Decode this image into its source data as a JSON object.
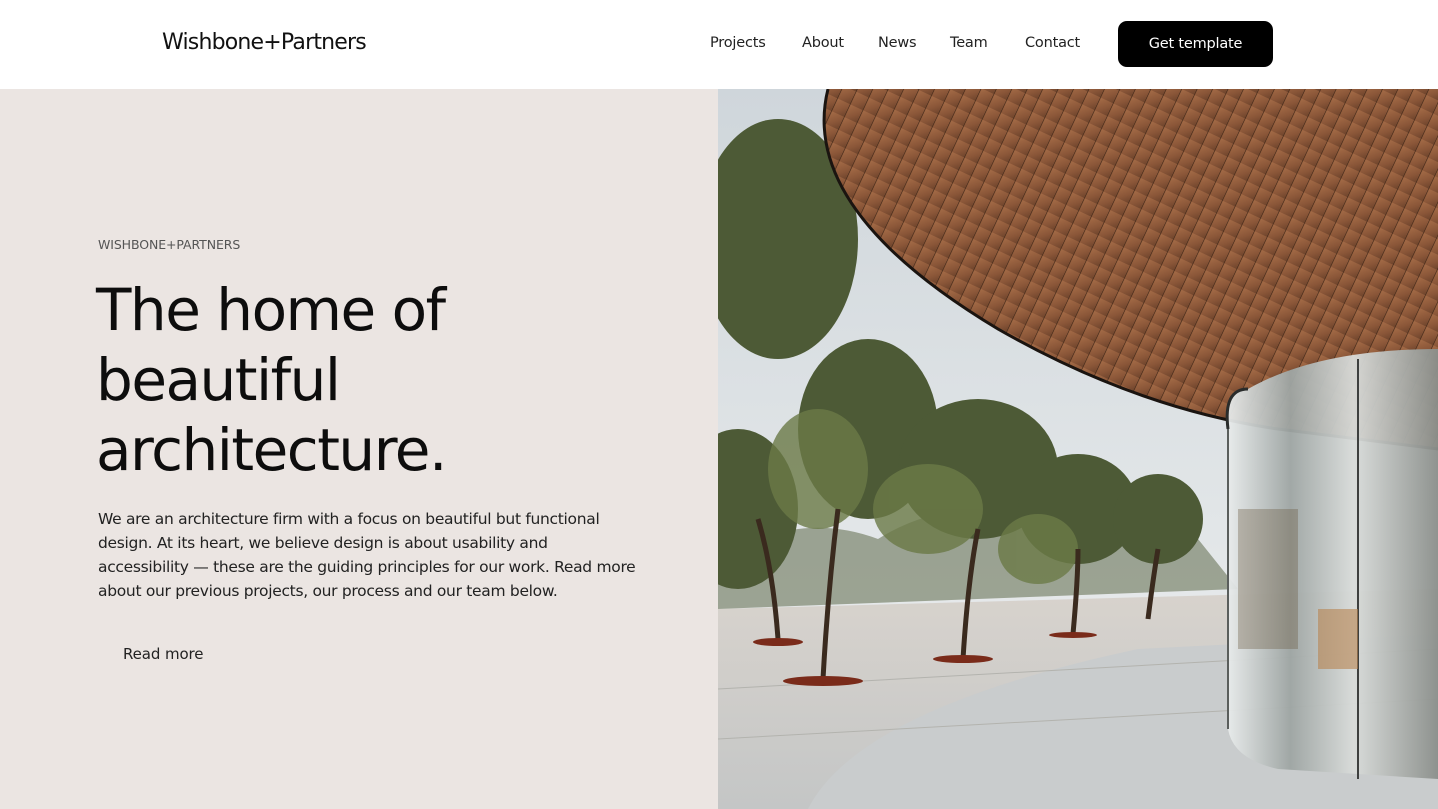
{
  "header": {
    "logo": "Wishbone+Partners",
    "nav": [
      {
        "label": "Projects"
      },
      {
        "label": "About"
      },
      {
        "label": "News"
      },
      {
        "label": "Team"
      },
      {
        "label": "Contact"
      }
    ],
    "cta_label": "Get template"
  },
  "hero": {
    "eyebrow": "WISHBONE+PARTNERS",
    "headline_lines": [
      "The home of",
      "beautiful",
      "architecture."
    ],
    "body": "We are an architecture firm with a focus on beautiful but functional design. At its heart, we believe design is about usability and accessibility — these are the guiding principles for our work. Read more about our previous projects, our process and our team below.",
    "read_more": "Read more"
  },
  "colors": {
    "hero_bg": "#ebe5e2",
    "button_bg": "#000000",
    "wood": "#8a5a3c",
    "sky": "#dfe3e6"
  }
}
